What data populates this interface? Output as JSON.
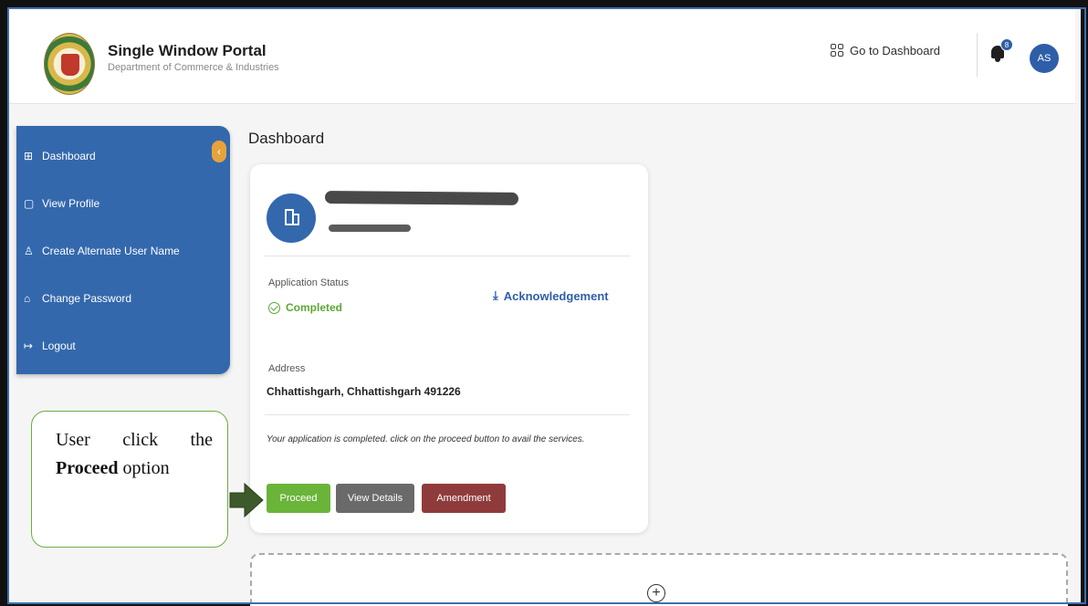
{
  "header": {
    "title": "Single Window Portal",
    "subtitle": "Department of Commerce & Industries",
    "goto_dashboard": "Go to Dashboard",
    "notification_count": "8",
    "avatar_initials": "AS"
  },
  "sidebar": {
    "items": [
      {
        "label": "Dashboard",
        "icon": "grid-icon"
      },
      {
        "label": "View Profile",
        "icon": "profile-icon"
      },
      {
        "label": "Create Alternate User Name",
        "icon": "user-add-icon"
      },
      {
        "label": "Change Password",
        "icon": "lock-icon"
      },
      {
        "label": "Logout",
        "icon": "logout-icon"
      }
    ]
  },
  "page": {
    "title": "Dashboard"
  },
  "card": {
    "status_label": "Application Status",
    "status_value": "Completed",
    "acknowledgement": "Acknowledgement",
    "address_label": "Address",
    "address_value": "Chhattishgarh, Chhattishgarh 491226",
    "note": "Your application is completed. click on the proceed button to avail the services.",
    "buttons": {
      "proceed": "Proceed",
      "view_details": "View Details",
      "amendment": "Amendment"
    }
  },
  "callout": {
    "line_prefix": "User click the",
    "bold": "Proceed",
    "suffix": "option"
  },
  "colors": {
    "sidebar": "#3468ad",
    "proceed": "#6ab43a",
    "view_details": "#6a6a6a",
    "amendment": "#8f3b3b",
    "completed": "#5aa832",
    "callout_border": "#6aae3f",
    "arrow": "#3d5a2a"
  }
}
